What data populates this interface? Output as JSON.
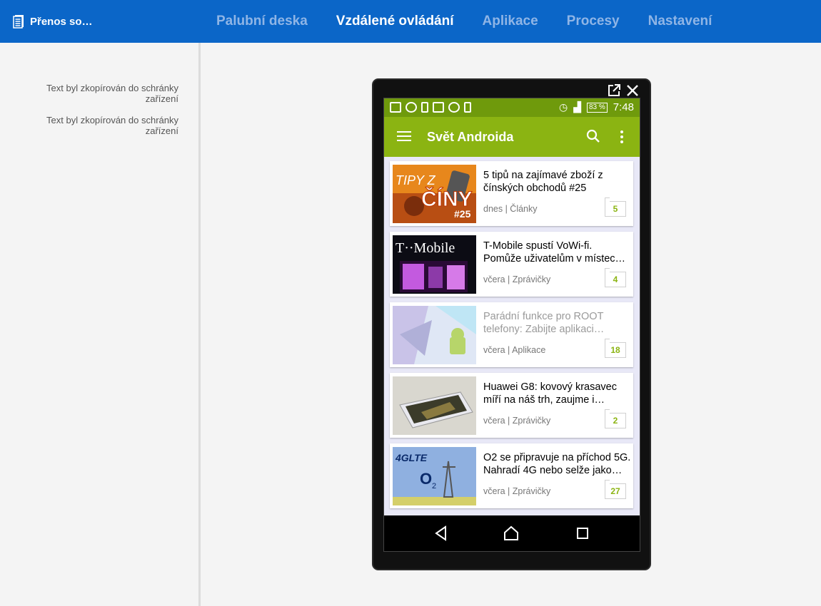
{
  "header": {
    "app_title": "Přenos so…",
    "tabs": [
      {
        "label": "Palubní deska",
        "active": false
      },
      {
        "label": "Vzdálené ovládání",
        "active": true
      },
      {
        "label": "Aplikace",
        "active": false
      },
      {
        "label": "Procesy",
        "active": false
      },
      {
        "label": "Nastavení",
        "active": false
      }
    ]
  },
  "sidebar": {
    "messages": [
      "Text byl zkopírován do schránky zařízení",
      "Text byl zkopírován do schránky zařízení"
    ]
  },
  "phone": {
    "status": {
      "battery": "83 %",
      "time": "7:48"
    },
    "app_title": "Svět Androida",
    "articles": [
      {
        "title": "5 tipů na zajímavé zboží z čínských obchodů #25",
        "meta": "dnes | Články",
        "comments": "5",
        "thumb_text": "TIPY Z ČÍNY #25",
        "faded": false
      },
      {
        "title": "T-Mobile spustí VoWi-fi. Pomůže uživatelům v místec…",
        "meta": "včera | Zprávičky",
        "comments": "4",
        "thumb_text": "T··Mobile",
        "faded": false
      },
      {
        "title": "Parádní funkce pro ROOT telefony: Zabijte aplikaci…",
        "meta": "včera | Aplikace",
        "comments": "18",
        "thumb_text": "",
        "faded": true
      },
      {
        "title": "Huawei G8: kovový krasavec míří na náš trh, zaujme i…",
        "meta": "včera | Zprávičky",
        "comments": "2",
        "thumb_text": "",
        "faded": false
      },
      {
        "title": "O2 se připravuje na příchod 5G. Nahradí 4G nebo selže jako…",
        "meta": "včera | Zprávičky",
        "comments": "27",
        "thumb_text": "4GLTE O2",
        "faded": false
      }
    ]
  },
  "colors": {
    "topbar": "#0b66c8",
    "status": "#6f9a0c",
    "appbar": "#8bb412"
  }
}
